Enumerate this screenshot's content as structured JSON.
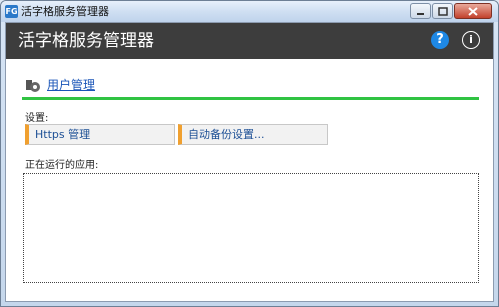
{
  "window": {
    "title": "活字格服务管理器",
    "app_icon_glyph": "FG",
    "controls": {
      "minimize": "–",
      "maximize": "▢",
      "close": "✕"
    }
  },
  "header": {
    "title": "活字格服务管理器",
    "help_glyph": "?",
    "info_glyph": "i"
  },
  "user_management": {
    "label": "用户管理"
  },
  "settings": {
    "label": "设置:",
    "buttons": [
      {
        "label": "Https 管理"
      },
      {
        "label": "自动备份设置..."
      }
    ]
  },
  "running_apps": {
    "label": "正在运行的应用:",
    "items": []
  },
  "colors": {
    "header_bg": "#3d3d3d",
    "accent_green": "#30c342",
    "button_accent": "#f0a030",
    "link": "#1a55b8",
    "help_blue": "#1e88e5"
  }
}
